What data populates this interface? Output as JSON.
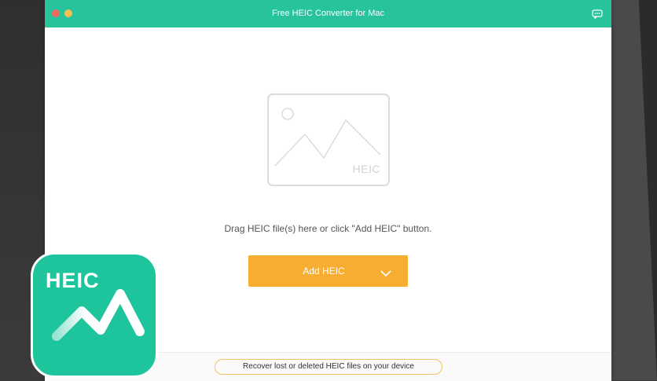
{
  "window": {
    "title": "Free HEIC Converter for Mac"
  },
  "drop_area": {
    "placeholder_label": "HEIC",
    "hint": "Drag HEIC file(s) here or click \"Add HEIC\" button."
  },
  "add_button": {
    "label": "Add HEIC"
  },
  "bottom_bar": {
    "recover_label": "Recover lost or deleted HEIC files on your device"
  },
  "app_icon": {
    "label": "HEIC"
  },
  "colors": {
    "title_bar": "#26c39d",
    "add_button": "#f6ad31",
    "app_icon": "#1ec49b",
    "recover_border": "#f3c263"
  },
  "icons": {
    "feedback": "feedback-icon",
    "chevron": "chevron-down-icon",
    "placeholder": "image-icon",
    "app_logo": "mountain-logo-icon"
  }
}
